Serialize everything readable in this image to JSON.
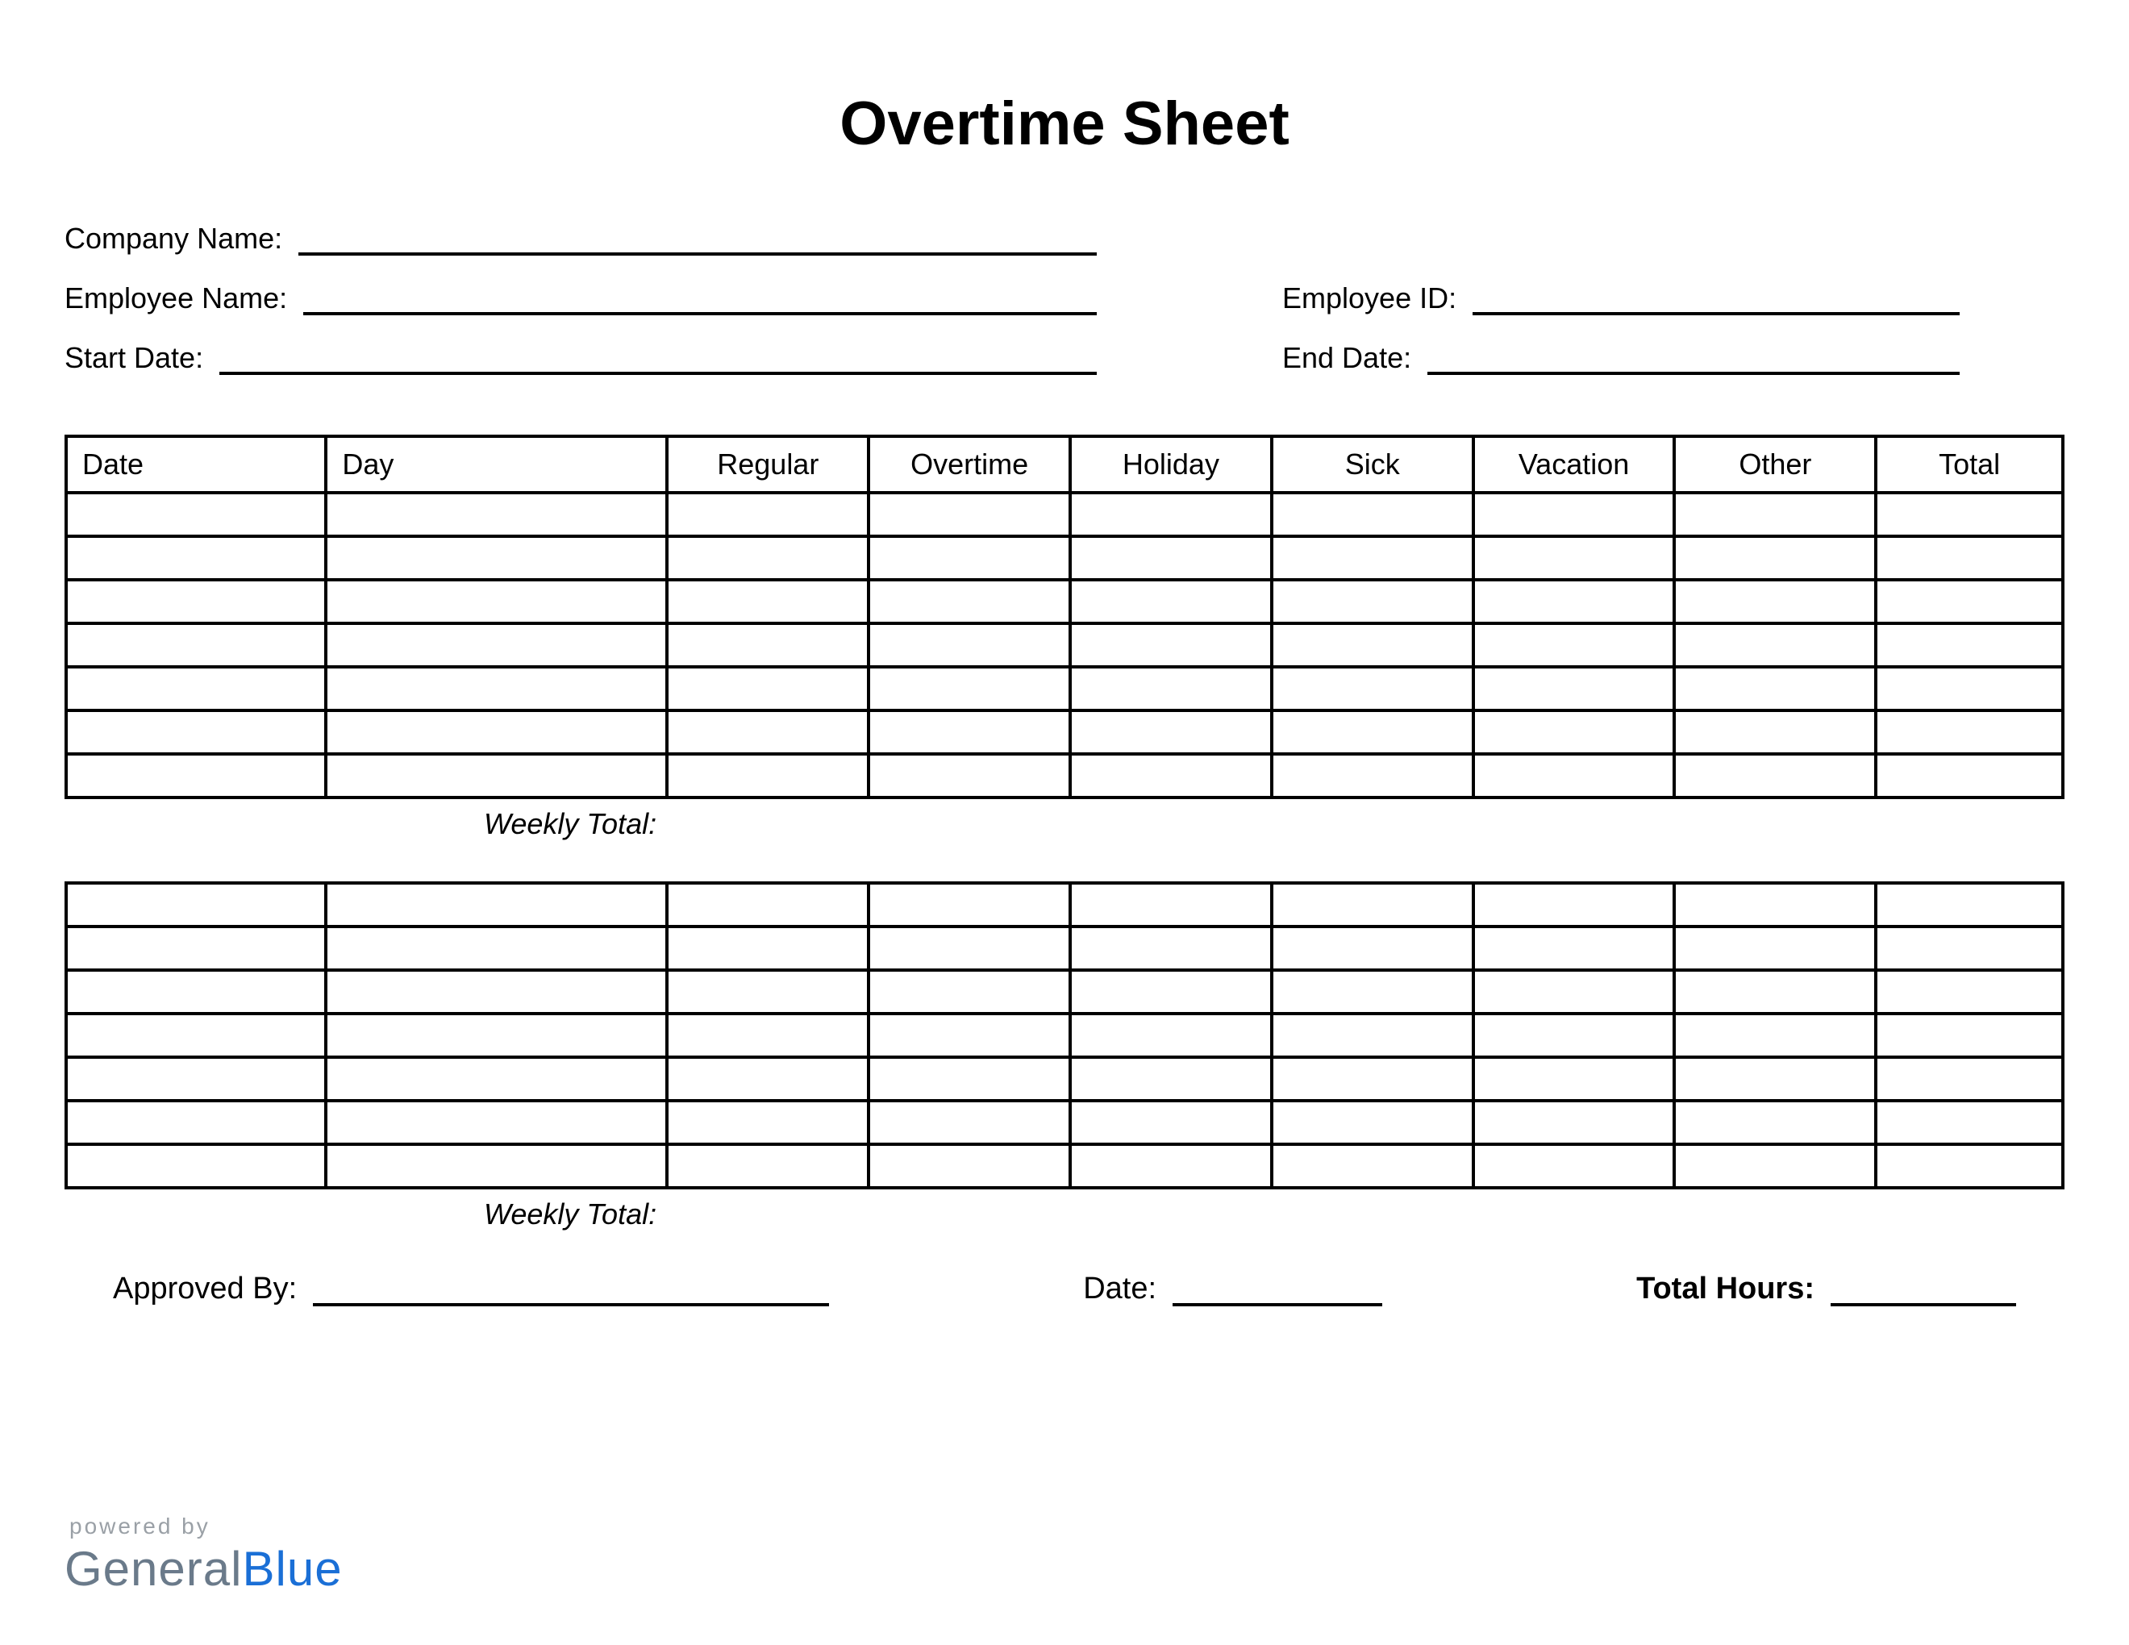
{
  "title": "Overtime Sheet",
  "info": {
    "company_label": "Company Name:",
    "employee_name_label": "Employee Name:",
    "start_date_label": "Start Date:",
    "employee_id_label": "Employee ID:",
    "end_date_label": "End Date:"
  },
  "columns": {
    "date": "Date",
    "day": "Day",
    "regular": "Regular",
    "overtime": "Overtime",
    "holiday": "Holiday",
    "sick": "Sick",
    "vacation": "Vacation",
    "other": "Other",
    "total": "Total"
  },
  "weekly_total_label": "Weekly Total:",
  "footer": {
    "approved_by_label": "Approved By:",
    "date_label": "Date:",
    "total_hours_label": "Total Hours:"
  },
  "brand": {
    "powered": "powered by",
    "general": "General",
    "blue": "Blue"
  }
}
